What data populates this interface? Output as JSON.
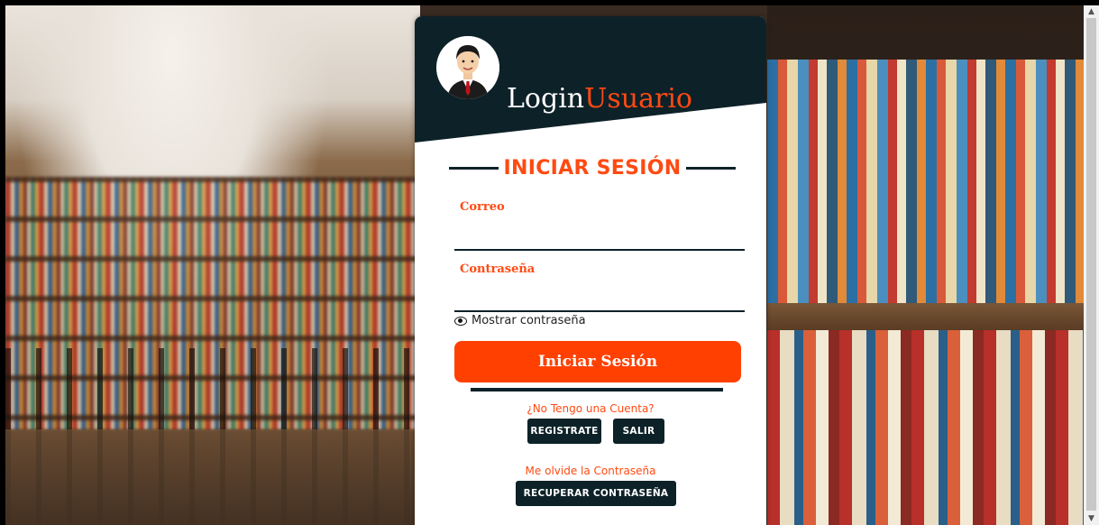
{
  "brand": {
    "part1": "Login",
    "part2": "Usuario"
  },
  "login": {
    "title": "INICIAR SESIÓN",
    "email_label": "Correo",
    "email_value": "",
    "password_label": "Contraseña",
    "password_value": "",
    "show_password": "Mostrar contraseña",
    "submit_label": "Iniciar Sesión"
  },
  "register": {
    "prompt": "¿No Tengo una Cuenta?",
    "register_label": "REGISTRATE",
    "exit_label": "SALIR"
  },
  "recover": {
    "prompt": "Me olvide la Contraseña",
    "button_label": "RECUPERAR CONTRASEÑA"
  },
  "icons": {
    "eye": "eye-icon",
    "avatar": "user-avatar"
  },
  "colors": {
    "accent": "#ff4a12",
    "dark": "#0d2128",
    "button": "#ff4000"
  }
}
